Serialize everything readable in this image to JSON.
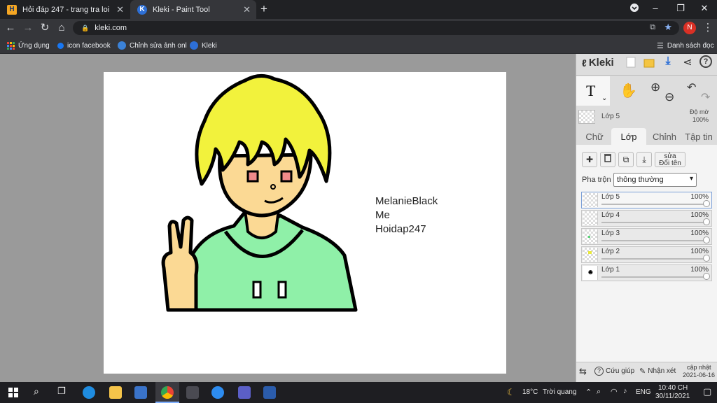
{
  "browser": {
    "tabs": [
      {
        "title": "Hỏi đáp 247 - trang tra loi",
        "icon": "hoidap-favicon",
        "active": false
      },
      {
        "title": "Kleki - Paint Tool",
        "icon": "kleki-favicon",
        "active": true
      }
    ],
    "new_tab_label": "+",
    "url": "kleki.com",
    "profile_initial": "N",
    "bookmarks": [
      {
        "label": "Ứng dụng",
        "icon": "apps-grid-icon"
      },
      {
        "label": "icon facebook",
        "icon": "bookmark-globe-icon"
      },
      {
        "label": "Chỉnh sửa ảnh onl",
        "icon": "photo-editor-icon"
      },
      {
        "label": "Kleki",
        "icon": "kleki-favicon"
      }
    ],
    "reading_list": "Danh sách đọc"
  },
  "canvas": {
    "text_lines": [
      "MelanieBlack",
      "Me",
      "Hoidap247"
    ]
  },
  "panel": {
    "logo": "Kleki",
    "current_layer": "Lớp 5",
    "opacity_label": "Độ mờ",
    "opacity_value": "100%",
    "tabs": [
      "Chữ",
      "Lớp",
      "Chỉnh",
      "Tập tin"
    ],
    "active_tab": "Lớp",
    "rename_label_top": "sửa",
    "rename_label": "Đổi tên",
    "blend_label": "Pha trộn",
    "blend_value": "thông thường",
    "layers": [
      {
        "name": "Lớp 5",
        "opacity": "100%",
        "active": true
      },
      {
        "name": "Lớp 4",
        "opacity": "100%",
        "active": false
      },
      {
        "name": "Lớp 3",
        "opacity": "100%",
        "active": false
      },
      {
        "name": "Lớp 2",
        "opacity": "100%",
        "active": false
      },
      {
        "name": "Lớp 1",
        "opacity": "100%",
        "active": false
      }
    ],
    "footer": {
      "help": "Cứu giúp",
      "feedback": "Nhận xét",
      "update_label": "cập nhật",
      "update_date": "2021-06-16"
    }
  },
  "taskbar": {
    "weather_temp": "18°C",
    "weather_desc": "Trời quang",
    "language": "ENG",
    "time": "10:40 CH",
    "date": "30/11/2021"
  },
  "colors": {
    "hair": "#f2f23c",
    "skin": "#fbd994",
    "hoodie": "#8ff0a8",
    "eye": "#f08a8a"
  }
}
